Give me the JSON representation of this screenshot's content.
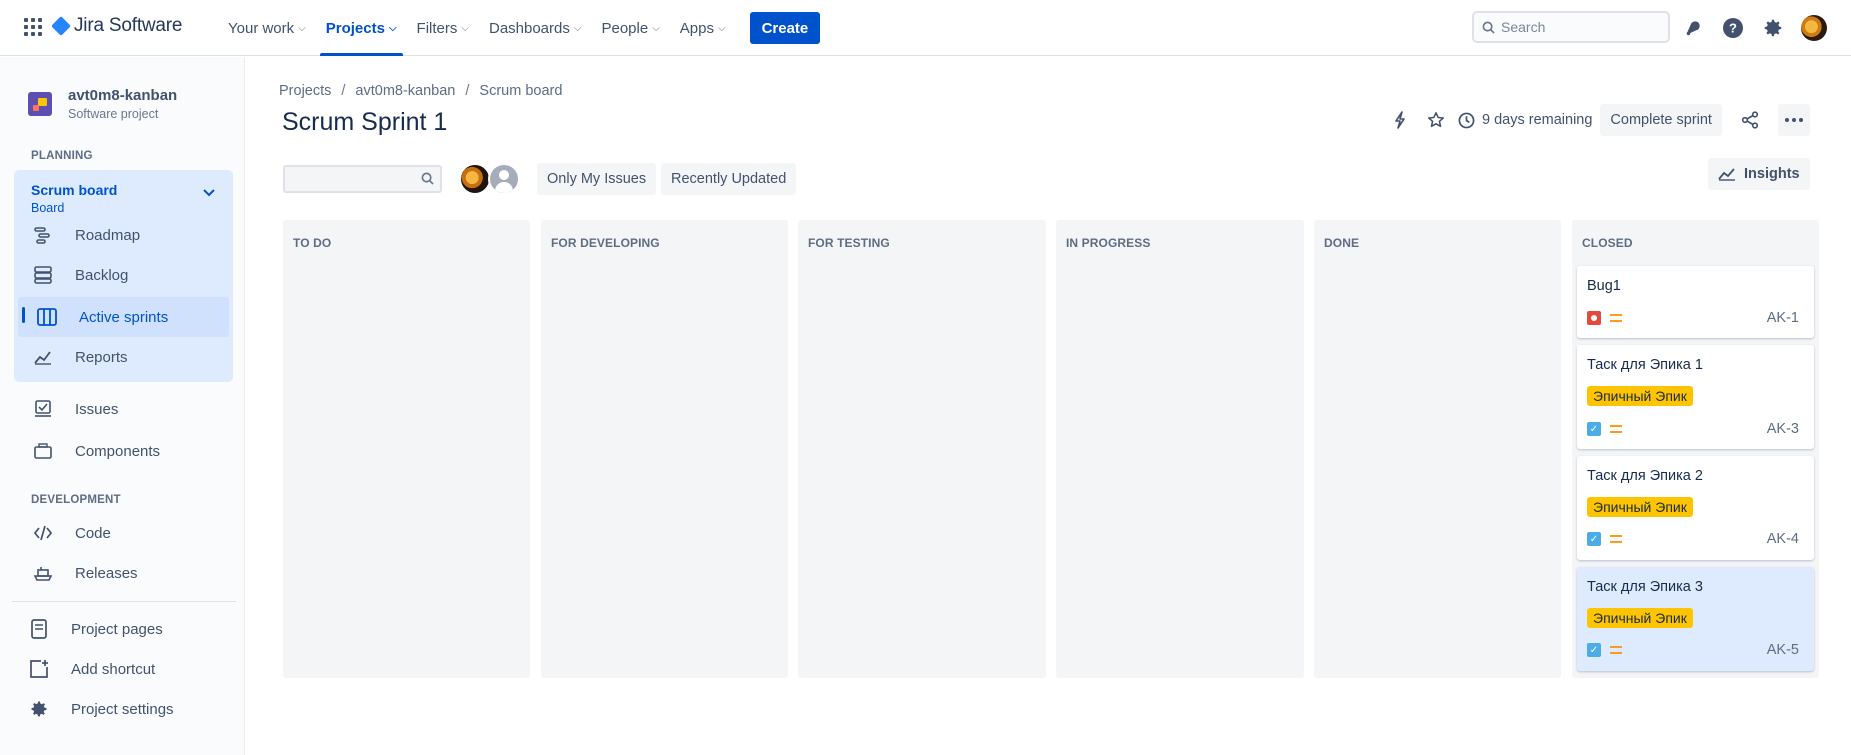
{
  "topnav": {
    "product": "Jira Software",
    "items": [
      {
        "label": "Your work",
        "active": false
      },
      {
        "label": "Projects",
        "active": true
      },
      {
        "label": "Filters",
        "active": false
      },
      {
        "label": "Dashboards",
        "active": false
      },
      {
        "label": "People",
        "active": false
      },
      {
        "label": "Apps",
        "active": false
      }
    ],
    "create_label": "Create",
    "search_placeholder": "Search"
  },
  "sidebar": {
    "project_name": "avt0m8-kanban",
    "project_type": "Software project",
    "planning_label": "PLANNING",
    "board": {
      "name": "Scrum board",
      "sub": "Board"
    },
    "board_items": [
      {
        "label": "Roadmap",
        "icon": "roadmap-icon"
      },
      {
        "label": "Backlog",
        "icon": "backlog-icon"
      },
      {
        "label": "Active sprints",
        "icon": "board-columns-icon",
        "active": true
      },
      {
        "label": "Reports",
        "icon": "reports-icon"
      }
    ],
    "items": [
      {
        "label": "Issues",
        "icon": "issues-icon"
      },
      {
        "label": "Components",
        "icon": "components-icon"
      }
    ],
    "development_label": "DEVELOPMENT",
    "dev_items": [
      {
        "label": "Code",
        "icon": "code-icon"
      },
      {
        "label": "Releases",
        "icon": "releases-icon"
      }
    ],
    "bottom_items": [
      {
        "label": "Project pages",
        "icon": "pages-icon"
      },
      {
        "label": "Add shortcut",
        "icon": "add-shortcut-icon"
      },
      {
        "label": "Project settings",
        "icon": "gear-icon"
      }
    ]
  },
  "breadcrumb": [
    "Projects",
    "avt0m8-kanban",
    "Scrum board"
  ],
  "title": "Scrum Sprint 1",
  "actions": {
    "days_remaining": "9 days remaining",
    "complete_sprint": "Complete sprint"
  },
  "filters": {
    "only_my_issues": "Only My Issues",
    "recently_updated": "Recently Updated",
    "insights": "Insights"
  },
  "columns": [
    "TO DO",
    "FOR DEVELOPING",
    "FOR TESTING",
    "IN PROGRESS",
    "DONE",
    "CLOSED"
  ],
  "cards": [
    {
      "title": "Bug1",
      "type": "bug",
      "epic": "",
      "key": "AK-1",
      "selected": false
    },
    {
      "title": "Таск для Эпика 1",
      "type": "task",
      "epic": "Эпичный Эпик",
      "key": "AK-3",
      "selected": false
    },
    {
      "title": "Таск для Эпика 2",
      "type": "task",
      "epic": "Эпичный Эпик",
      "key": "AK-4",
      "selected": false
    },
    {
      "title": "Таск для Эпика 3",
      "type": "task",
      "epic": "Эпичный Эпик",
      "key": "AK-5",
      "selected": true
    }
  ],
  "colors": {
    "brand": "#0052cc",
    "epic": "#ffc400",
    "bug": "#e5493a",
    "task": "#4bade8",
    "priority_medium": "#ff991f"
  }
}
